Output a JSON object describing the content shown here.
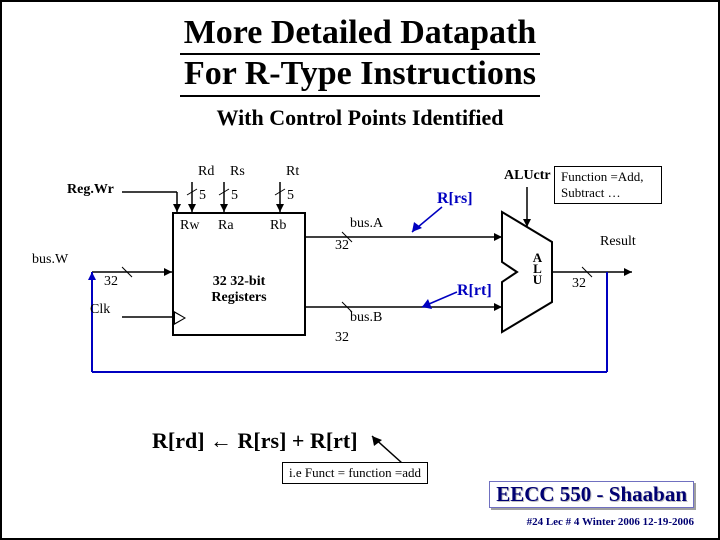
{
  "title_line1": "More Detailed Datapath",
  "title_line2": "For R-Type Instructions",
  "subtitle": "With Control Points Identified",
  "regwr": "Reg.Wr",
  "rd": "Rd",
  "rs": "Rs",
  "rt": "Rt",
  "five_a": "5",
  "five_b": "5",
  "five_c": "5",
  "rw": "Rw",
  "ra": "Ra",
  "rb": "Rb",
  "regfile_text": "32 32-bit\nRegisters",
  "busw": "bus.W",
  "busw_32": "32",
  "clk": "Clk",
  "busa": "bus.A",
  "busa_32": "32",
  "busb": "bus.B",
  "busb_32": "32",
  "rrs": "R[rs]",
  "rrt": "R[rt]",
  "aluctr": "ALUctr",
  "aluctr_note": "Function =Add, Subtract …",
  "alu": "ALU",
  "result": "Result",
  "result_32": "32",
  "equation": "R[rd] ←  R[rs]  +  R[rt]",
  "funct_box": "i.e Funct = function =add",
  "course": "EECC 550 - Shaaban",
  "footer": "#24   Lec # 4   Winter 2006   12-19-2006"
}
